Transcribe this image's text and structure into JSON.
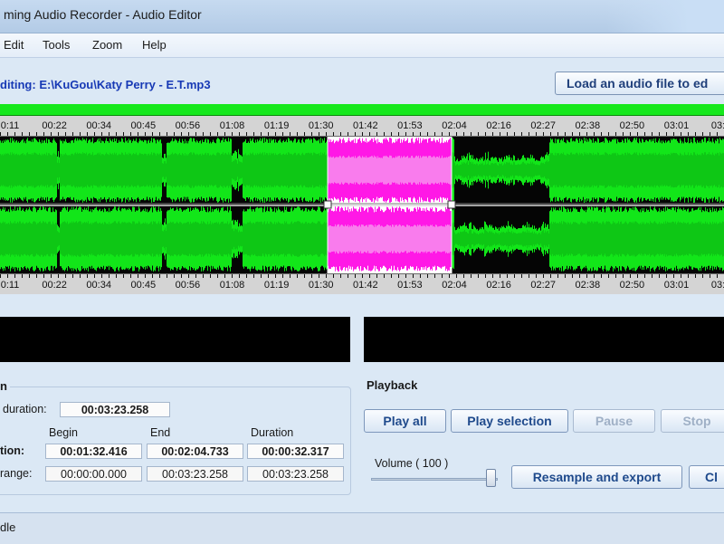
{
  "window": {
    "title": "ming Audio Recorder - Audio Editor"
  },
  "menu": {
    "items": [
      "Edit",
      "Tools",
      "Zoom",
      "Help"
    ]
  },
  "editing": {
    "label": "diting: E:\\KuGou\\Katy Perry - E.T.mp3",
    "load_button": "Load an audio file to ed"
  },
  "timeline": {
    "top_ticks": [
      "0:11",
      "00:22",
      "00:34",
      "00:45",
      "00:56",
      "01:08",
      "01:19",
      "01:30",
      "01:42",
      "01:53",
      "02:04",
      "02:16",
      "02:27",
      "02:38",
      "02:50",
      "03:01",
      "03:1"
    ],
    "bottom_ticks": [
      "0:11",
      "00:22",
      "00:34",
      "00:45",
      "00:56",
      "01:08",
      "01:19",
      "01:30",
      "01:42",
      "01:53",
      "02:04",
      "02:16",
      "02:27",
      "02:38",
      "02:50",
      "03:01",
      "03:1"
    ],
    "colors": {
      "waveform": "#12e619",
      "waveform_dark": "#0a8c0f",
      "selection": "#ff18e6",
      "selection_bg": "#ffffff",
      "progress": "#16e81c"
    }
  },
  "selection": {
    "group_title": "n",
    "total_duration_label": "duration:",
    "total_duration": "00:03:23.258",
    "col_begin": "Begin",
    "col_end": "End",
    "col_duration": "Duration",
    "sel_row_label": "tion:",
    "sel_begin": "00:01:32.416",
    "sel_end": "00:02:04.733",
    "sel_duration": "00:00:32.317",
    "range_row_label": "range:",
    "range_begin": "00:00:00.000",
    "range_end": "00:03:23.258",
    "range_duration": "00:03:23.258"
  },
  "playback": {
    "title": "Playback",
    "play_all": "Play all",
    "play_selection": "Play selection",
    "pause": "Pause",
    "stop": "Stop",
    "volume_label": "Volume ( 100 )",
    "volume_value": 100,
    "resample_export": "Resample and export",
    "close": "Cl"
  },
  "status": {
    "text": "dle"
  }
}
